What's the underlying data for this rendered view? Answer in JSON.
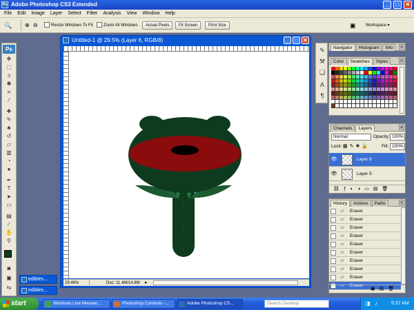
{
  "app": {
    "title": "Adobe Photoshop CS3 Extended",
    "logo": "Ps"
  },
  "window_controls": {
    "minimize": "_",
    "maximize": "□",
    "close": "✕"
  },
  "menu": [
    "File",
    "Edit",
    "Image",
    "Layer",
    "Select",
    "Filter",
    "Analysis",
    "View",
    "Window",
    "Help"
  ],
  "options_bar": {
    "tool_icon": "zoom-icon",
    "resize_windows_label": "Resize Windows To Fit",
    "zoom_all_label": "Zoom All Windows",
    "actual_pixels": "Actual Pixels",
    "fit_screen": "Fit Screen",
    "print_size": "Print Size",
    "workspace": "Workspace ▾"
  },
  "document": {
    "title": "Untitled-1 @ 29.5% (Layer 6, RGB/8)",
    "zoom": "29.46%",
    "doc_info": "Doc: 11.4M/14.8M"
  },
  "colors": {
    "foreground": "#0f3d1f",
    "background": "#ffffff",
    "stem": "#0e3b1f",
    "band": "#8a0c0c",
    "accent": "#3a6fd4"
  },
  "panels": {
    "navigator_tabs": [
      "Navigator",
      "Histogram",
      "Info"
    ],
    "color_tabs": [
      "Color",
      "Swatches",
      "Styles"
    ],
    "layers_tabs": [
      "Channels",
      "Layers"
    ],
    "blend_mode": "Normal",
    "opacity_label": "Opacity:",
    "opacity_value": "100%",
    "lock_label": "Lock:",
    "fill_label": "Fill:",
    "fill_value": "100%",
    "layers": [
      "Layer 6",
      "Layer 5"
    ],
    "history_tabs": [
      "History",
      "Actions",
      "Paths"
    ],
    "history_items": [
      "Eraser",
      "Eraser",
      "Eraser",
      "Eraser",
      "Eraser",
      "Eraser",
      "Eraser",
      "Eraser",
      "Eraser",
      "Eraser"
    ]
  },
  "minimized_windows": [
    "edibles...",
    "edibles..."
  ],
  "taskbar": {
    "start": "start",
    "items": [
      "Windows Live Messen...",
      "Photoshop Contests -...",
      "Adobe Photoshop CS..."
    ],
    "search_placeholder": "Search Desktop",
    "clock": "9:37 AM"
  }
}
